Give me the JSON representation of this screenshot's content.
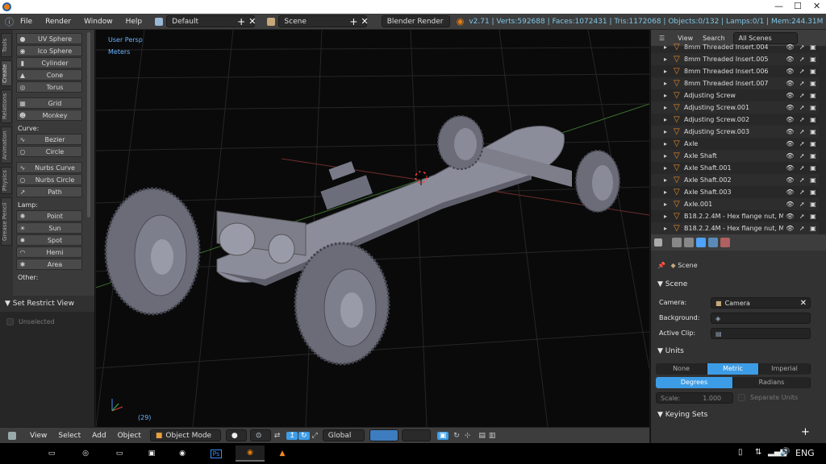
{
  "menubar": {
    "items": [
      "File",
      "Render",
      "Window",
      "Help"
    ],
    "layout": "Default",
    "scene": "Scene",
    "engine": "Blender Render",
    "stats": "v2.71 | Verts:592688 | Faces:1072431 | Tris:1172068 | Objects:0/132 | Lamps:0/1 | Mem:244.31M"
  },
  "toolshelf": {
    "vtabs": [
      "Tools",
      "Create",
      "Relations",
      "Animation",
      "Physics",
      "Grease Pencil"
    ],
    "mesh_items": [
      "UV Sphere",
      "Ico Sphere",
      "Cylinder",
      "Cone",
      "Torus"
    ],
    "mesh_items2": [
      "Grid",
      "Monkey"
    ],
    "curve_label": "Curve:",
    "curve_items": [
      "Bezier",
      "Circle"
    ],
    "surface_items": [
      "Nurbs Curve",
      "Nurbs Circle",
      "Path"
    ],
    "lamp_label": "Lamp:",
    "lamp_items": [
      "Point",
      "Sun",
      "Spot",
      "Hemi",
      "Area"
    ],
    "other_label": "Other:"
  },
  "restrict": {
    "title": "Set Restrict View",
    "option": "Unselected"
  },
  "viewport": {
    "view_name": "User Persp",
    "units": "Meters",
    "frame": "(29)"
  },
  "header3d": {
    "items": [
      "View",
      "Select",
      "Add",
      "Object"
    ],
    "mode": "Object Mode",
    "orientation": "Global"
  },
  "outliner": {
    "menu": [
      "View",
      "Search"
    ],
    "filter": "All Scenes",
    "rows": [
      "8mm Threaded Insert.004",
      "8mm Threaded Insert.005",
      "8mm Threaded Insert.006",
      "8mm Threaded Insert.007",
      "Adjusting Screw",
      "Adjusting Screw.001",
      "Adjusting Screw.002",
      "Adjusting Screw.003",
      "Axle",
      "Axle Shaft",
      "Axle Shaft.001",
      "Axle Shaft.002",
      "Axle Shaft.003",
      "Axle.001",
      "B18.2.2.4M - Hex flange nut, M",
      "B18.2.2.4M - Hex flange nut, M"
    ]
  },
  "properties": {
    "breadcrumb": "Scene",
    "scene_section": "Scene",
    "camera_label": "Camera:",
    "camera_value": "Camera",
    "background_label": "Background:",
    "active_clip_label": "Active Clip:",
    "units_section": "Units",
    "unit_system": [
      "None",
      "Metric",
      "Imperial"
    ],
    "rotation": [
      "Degrees",
      "Radians"
    ],
    "scale_label": "Scale:",
    "scale_value": "1.000",
    "separate_units": "Separate Units",
    "keying_section": "Keying Sets"
  },
  "taskbar": {
    "language": "ENG"
  },
  "colors": {
    "accent": "#3d9ce6",
    "stats": "#7fc6e6",
    "viewport_bg": "#0a0a0a"
  }
}
